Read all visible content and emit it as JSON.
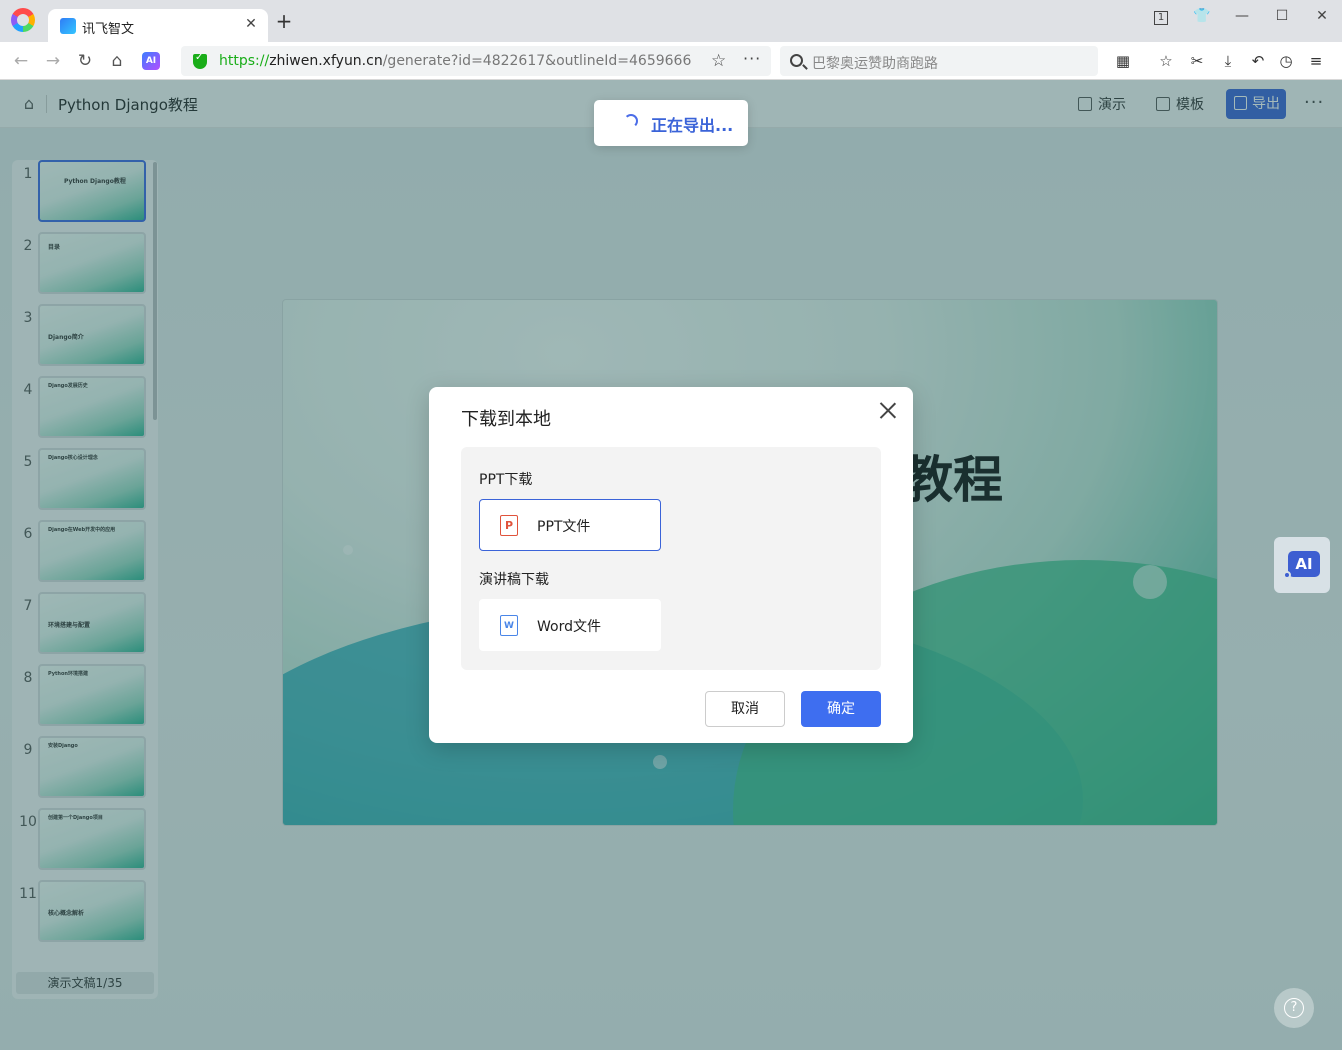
{
  "browser": {
    "tab_title": "讯飞智文",
    "new_tab": "+",
    "url_scheme": "https://",
    "url_host": "zhiwen.xfyun.cn",
    "url_path": "/generate?id=4822617&outlineId=4659666",
    "search_placeholder": "巴黎奥运赞助商跑路",
    "ai_extension": "AI",
    "window_controls": [
      "1",
      "shirt-icon",
      "minimize-icon",
      "maximize-icon",
      "close-icon"
    ]
  },
  "header": {
    "doc_title": "Python Django教程",
    "present_label": "演示",
    "template_label": "模板",
    "export_label": "导出"
  },
  "toast": {
    "text": "正在导出..."
  },
  "thumbnails": {
    "items": [
      {
        "num": "1",
        "caption": "Python Django教程",
        "active": true
      },
      {
        "num": "2",
        "caption": "目录"
      },
      {
        "num": "3",
        "caption": "Django简介"
      },
      {
        "num": "4",
        "caption": "Django发展历史"
      },
      {
        "num": "5",
        "caption": "Django核心设计理念"
      },
      {
        "num": "6",
        "caption": "Django在Web开发中的应用"
      },
      {
        "num": "7",
        "caption": "环境搭建与配置"
      },
      {
        "num": "8",
        "caption": "Python环境搭建"
      },
      {
        "num": "9",
        "caption": "安装Django"
      },
      {
        "num": "10",
        "caption": "创建第一个Django项目"
      },
      {
        "num": "11",
        "caption": "核心概念解析"
      }
    ],
    "footer": "演示文稿1/35"
  },
  "slide": {
    "title_fragment": "教程"
  },
  "modal": {
    "title": "下载到本地",
    "ppt_section": "PPT下载",
    "ppt_option": "PPT文件",
    "ppt_icon_letter": "P",
    "speech_section": "演讲稿下载",
    "word_option": "Word文件",
    "word_icon_letter": "W",
    "cancel": "取消",
    "confirm": "确定"
  },
  "floating": {
    "ai_label": "AI",
    "help": "?"
  },
  "colors": {
    "accent": "#3a63d8",
    "confirm": "#3e6ef0",
    "ppt": "#e0533c",
    "word": "#4a86e8"
  }
}
